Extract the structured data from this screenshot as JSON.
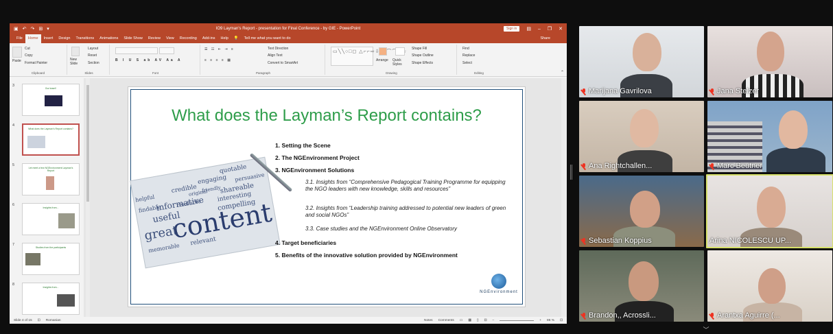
{
  "window": {
    "title": "IO9 Layman's Report - presentation for Final Conference - by GIE  -  PowerPoint",
    "sign_in": "Sign in"
  },
  "ribbon_tabs": [
    "File",
    "Home",
    "Insert",
    "Design",
    "Transitions",
    "Animations",
    "Slide Show",
    "Review",
    "View",
    "Recording",
    "Add-ins",
    "Help"
  ],
  "tell_me": "Tell me what you want to do",
  "share": "Share",
  "ribbon": {
    "clipboard": {
      "label": "Clipboard",
      "paste": "Paste",
      "cut": "Cut",
      "copy": "Copy",
      "format_painter": "Format Painter"
    },
    "slides": {
      "label": "Slides",
      "new_slide": "New Slide",
      "layout": "Layout",
      "reset": "Reset",
      "section": "Section"
    },
    "font": {
      "label": "Font"
    },
    "paragraph": {
      "label": "Paragraph",
      "text_direction": "Text Direction",
      "align_text": "Align Text",
      "convert": "Convert to SmartArt"
    },
    "drawing": {
      "label": "Drawing",
      "arrange": "Arrange",
      "quick_styles": "Quick Styles",
      "shape_fill": "Shape Fill",
      "shape_outline": "Shape Outline",
      "shape_effects": "Shape Effects"
    },
    "editing": {
      "label": "Editing",
      "find": "Find",
      "replace": "Replace",
      "select": "Select"
    }
  },
  "thumbnails": [
    {
      "num": "3",
      "text": "Our team!!"
    },
    {
      "num": "4",
      "text": "What does the Layman's Report contains?"
    },
    {
      "num": "5",
      "text": "Let meet a few NGEnvironment Layman's Report"
    },
    {
      "num": "6",
      "text": "Insights from..."
    },
    {
      "num": "7",
      "text": "Studies from the participants"
    },
    {
      "num": "8",
      "text": "Insights from..."
    }
  ],
  "slide": {
    "title": "What does the Layman’s Report contains?",
    "items": [
      "1. Setting the Scene",
      "2. The NGEnvironment Project",
      "3. NGEnvironment Solutions",
      "4. Target beneficiaries",
      "5. Benefits of the innovative solution provided by NGEnvironment"
    ],
    "subitems": [
      "3.1. Insights from “Comprehensive Pedagogical Training Programme for equipping the NGO leaders with new knowledge, skills and resources”",
      "3.2. Insights from “Leadership training addressed to potential new leaders of green and social NGOs”",
      "3.3. Case studies and the NGEnvironment Online Observatory"
    ],
    "image_words": [
      "content",
      "great",
      "useful",
      "informative",
      "credible",
      "engaging",
      "quotable",
      "shareable",
      "interesting",
      "compelling",
      "persuasive",
      "helpful",
      "friendly",
      "original",
      "readable",
      "relevant",
      "findable",
      "memorable"
    ],
    "logo_text": "NGEnvironment"
  },
  "status": {
    "slide_info": "Slide 4 of 15",
    "language": "Romanian",
    "notes": "Notes",
    "comments": "Comments",
    "zoom": "86 %"
  },
  "participants": [
    {
      "name": "Marijana Gavrilova",
      "muted": true
    },
    {
      "name": "Jana Stelzer",
      "muted": true
    },
    {
      "name": "Ana Rightchallen...",
      "muted": true
    },
    {
      "name": "Marc Beutner",
      "muted": true
    },
    {
      "name": "Sebastian Koppius",
      "muted": true
    },
    {
      "name": "Arina NICOLESCU UP...",
      "muted": false
    },
    {
      "name": "Brandon,, Acrossli...",
      "muted": true
    },
    {
      "name": "Arantxa Aguirre (...",
      "muted": true
    }
  ],
  "colors": {
    "ppt_accent": "#b7472a",
    "slide_title": "#2e9d4a",
    "active_speaker": "#d7e16a",
    "muted": "#e32222"
  }
}
